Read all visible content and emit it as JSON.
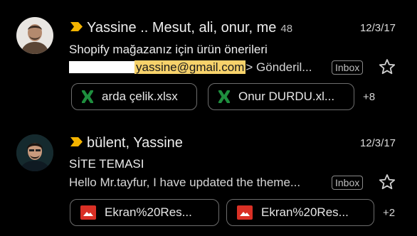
{
  "emails": [
    {
      "sender": "Yassine .. Mesut, ali, onur, me",
      "count": "48",
      "date": "12/3/17",
      "subject": "Shopify mağazanız için ürün önerileri",
      "snippet_highlight": "yassine@gmail.com",
      "snippet_tail": "> Gönderil...",
      "label": "Inbox",
      "attachments": [
        "arda çelik.xlsx",
        "Onur DURDU.xl..."
      ],
      "more_attachments": "+8"
    },
    {
      "sender": "bülent, Yassine",
      "date": "12/3/17",
      "subject": "SİTE TEMASI",
      "snippet": "Hello Mr.tayfur, I have updated the theme...",
      "label": "Inbox",
      "attachments": [
        "Ekran%20Res...",
        "Ekran%20Res..."
      ],
      "more_attachments": "+2"
    }
  ],
  "colors": {
    "important_marker": "#f4b400",
    "excel_icon": "#1e8e3e",
    "image_icon": "#d93025",
    "highlight": "#f7d26b"
  },
  "icons": {
    "important": "important-marker-icon",
    "excel": "excel-file-icon",
    "image": "image-file-icon",
    "star": "star-outline-icon"
  }
}
